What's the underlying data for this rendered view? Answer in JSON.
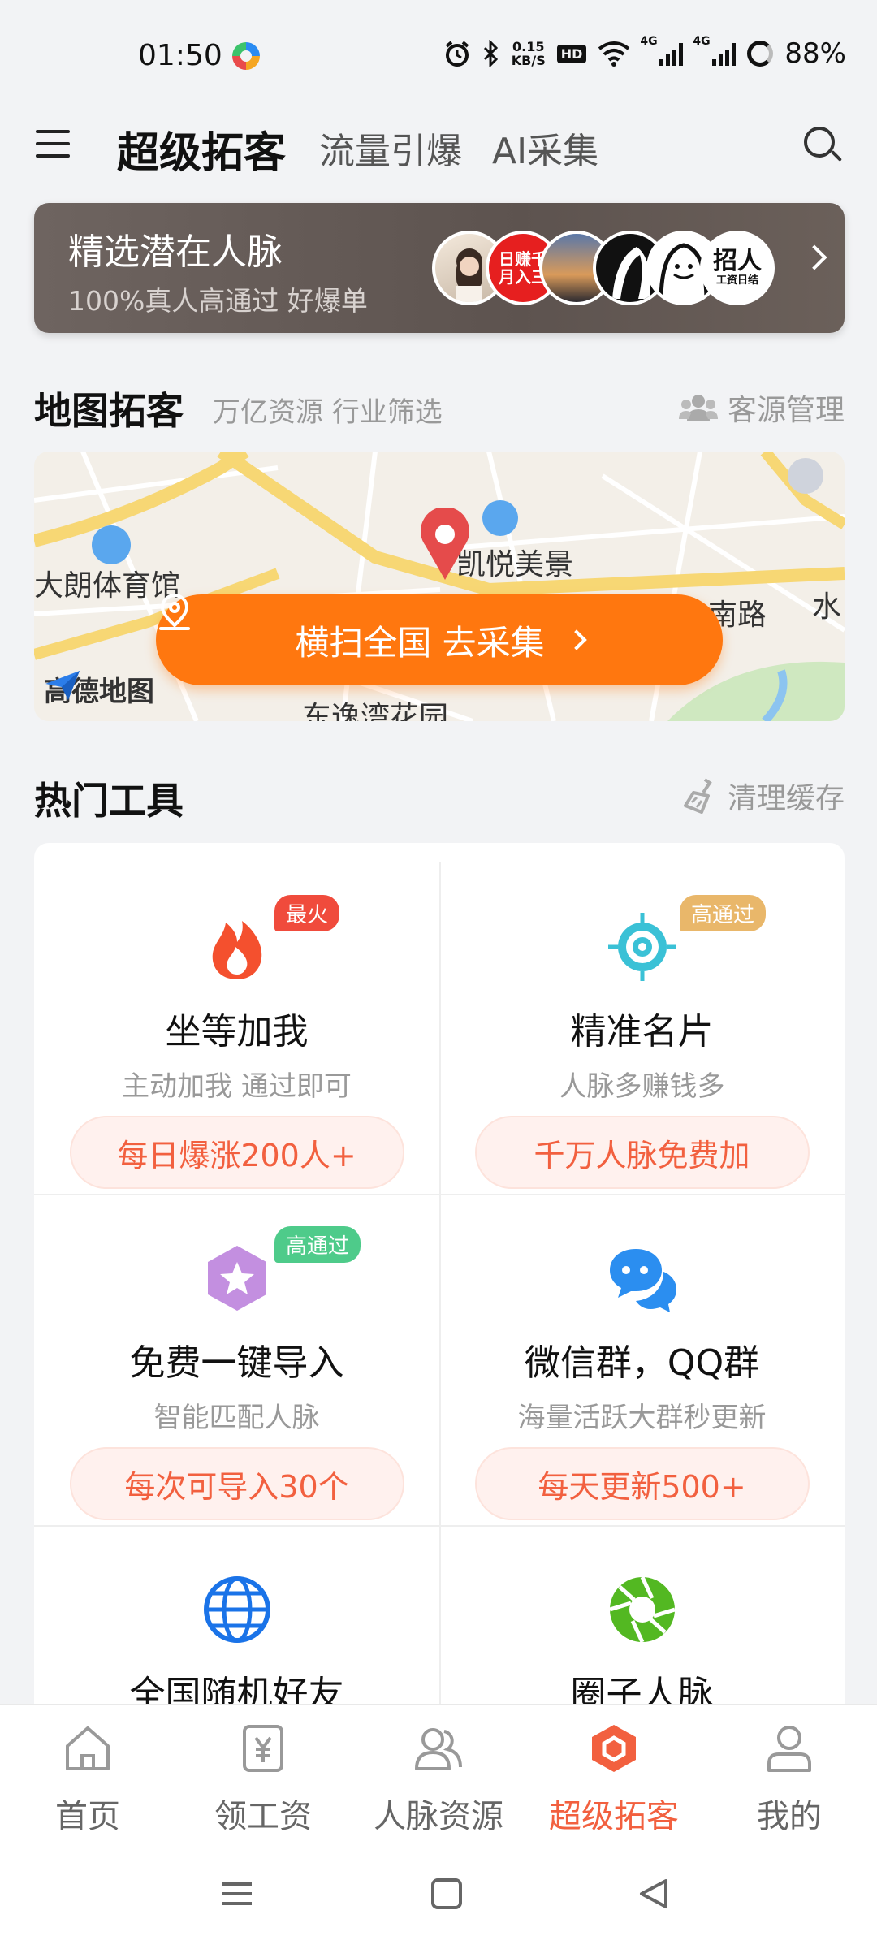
{
  "status_bar": {
    "time": "01:50",
    "net_speed_value": "0.15",
    "net_speed_unit": "KB/S",
    "hd": "HD",
    "sim1": "4G",
    "sim2": "4G",
    "battery": "88%"
  },
  "header": {
    "tabs": [
      {
        "label": "超级拓客",
        "active": true
      },
      {
        "label": "流量引爆"
      },
      {
        "label": "AI采集"
      }
    ]
  },
  "banner": {
    "title": "精选潜在人脉",
    "subtitle": "100%真人高通过 好爆单",
    "avatars": [
      {
        "kind": "photo"
      },
      {
        "text": "日赚千\n月入三"
      },
      {
        "kind": "sunset"
      },
      {
        "kind": "sketch"
      },
      {
        "kind": "sketch"
      },
      {
        "text": "招人",
        "sub": "工资日结"
      }
    ]
  },
  "map_section": {
    "title": "地图拓客",
    "subtitle": "万亿资源 行业筛选",
    "action": "客源管理"
  },
  "map": {
    "labels": [
      "大朗体育馆",
      "凯悦美景",
      "南路",
      "水",
      "东逸湾花园"
    ],
    "logo_text": "高德地图",
    "cta": "横扫全国 去采集"
  },
  "tools_section": {
    "title": "热门工具",
    "action": "清理缓存"
  },
  "tools": [
    {
      "name": "坐等加我",
      "desc": "主动加我 通过即可",
      "button": "每日爆涨200人+",
      "badge": "最火",
      "badge_color": "#f04b3c",
      "icon": "fire-icon"
    },
    {
      "name": "精准名片",
      "desc": "人脉多赚钱多",
      "button": "千万人脉免费加",
      "badge": "高通过",
      "badge_color": "#e9b76a",
      "icon": "target-icon"
    },
    {
      "name": "免费一键导入",
      "desc": "智能匹配人脉",
      "button": "每次可导入30个",
      "badge": "高通过",
      "badge_color": "#4ecb8a",
      "icon": "star-hexagon-icon"
    },
    {
      "name": "微信群，QQ群",
      "desc": "海量活跃大群秒更新",
      "button": "每天更新500+",
      "icon": "chat-bubbles-icon"
    },
    {
      "name": "全国随机好友",
      "icon": "globe-icon"
    },
    {
      "name": "圈子人脉",
      "icon": "aperture-icon"
    }
  ],
  "bottom_nav": [
    {
      "label": "首页",
      "icon": "home-icon"
    },
    {
      "label": "领工资",
      "icon": "wallet-icon"
    },
    {
      "label": "人脉资源",
      "icon": "contacts-icon"
    },
    {
      "label": "超级拓客",
      "icon": "hexagon-icon",
      "active": true
    },
    {
      "label": "我的",
      "icon": "profile-icon"
    }
  ],
  "colors": {
    "accent": "#ff770f",
    "active_nav": "#f2603f",
    "button_text": "#f2603f"
  }
}
